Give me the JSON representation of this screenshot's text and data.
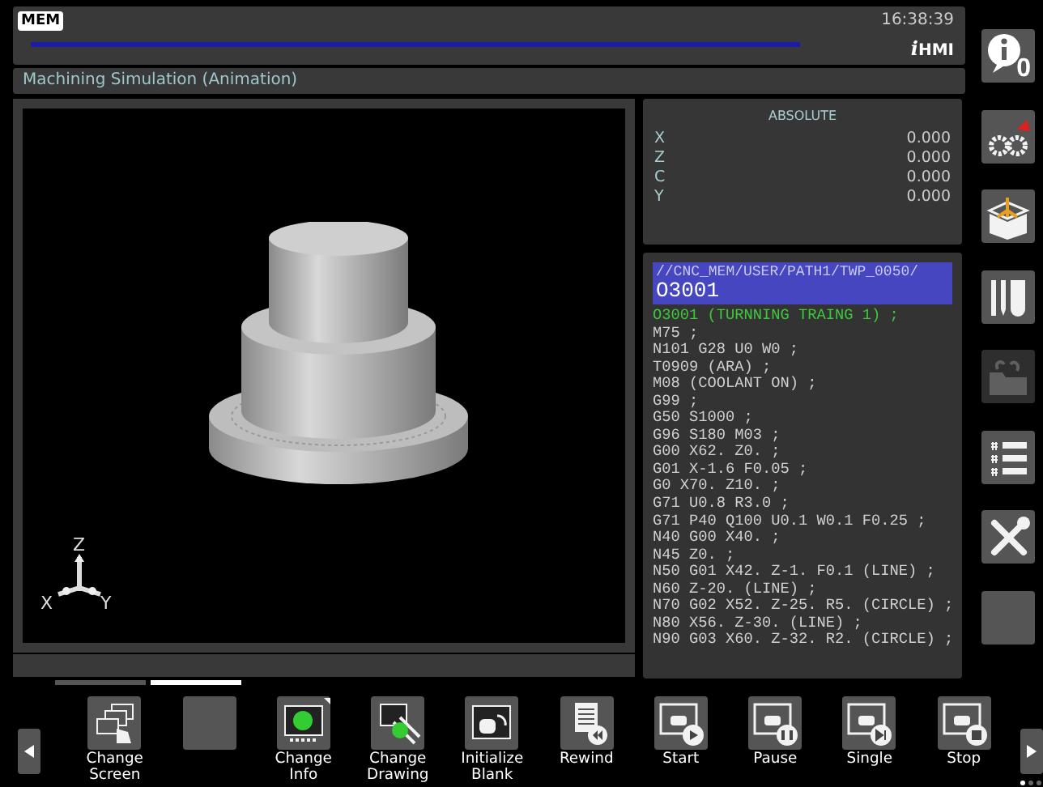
{
  "header": {
    "mode": "MEM",
    "time": "16:38:39",
    "logo": "iHMI"
  },
  "title": "Machining Simulation (Animation)",
  "simulation": {
    "axis_labels": [
      "Z",
      "X",
      "Y"
    ]
  },
  "position": {
    "title": "ABSOLUTE",
    "axes": [
      {
        "name": "X",
        "value": "0.000"
      },
      {
        "name": "Z",
        "value": "0.000"
      },
      {
        "name": "C",
        "value": "0.000"
      },
      {
        "name": "Y",
        "value": "0.000"
      }
    ]
  },
  "program": {
    "path": "//CNC_MEM/USER/PATH1/TWP_0050/",
    "name": "O3001",
    "lines": [
      {
        "text": "O3001 (TURNNING TRAING 1) ;",
        "current": true
      },
      {
        "text": "M75 ;",
        "current": false
      },
      {
        "text": "N101 G28 U0 W0 ;",
        "current": false
      },
      {
        "text": "T0909 (ARA) ;",
        "current": false
      },
      {
        "text": "M08 (COOLANT ON) ;",
        "current": false
      },
      {
        "text": "G99 ;",
        "current": false
      },
      {
        "text": "G50 S1000 ;",
        "current": false
      },
      {
        "text": "G96 S180 M03 ;",
        "current": false
      },
      {
        "text": "G00 X62. Z0. ;",
        "current": false
      },
      {
        "text": "G01 X-1.6 F0.05 ;",
        "current": false
      },
      {
        "text": "G0 X70. Z10. ;",
        "current": false
      },
      {
        "text": "G71 U0.8 R3.0 ;",
        "current": false
      },
      {
        "text": "G71 P40 Q100 U0.1 W0.1 F0.25 ;",
        "current": false
      },
      {
        "text": "N40 G00 X40. ;",
        "current": false
      },
      {
        "text": "N45 Z0. ;",
        "current": false
      },
      {
        "text": "N50 G01 X42. Z-1. F0.1 (LINE) ;",
        "current": false
      },
      {
        "text": "N60 Z-20. (LINE) ;",
        "current": false
      },
      {
        "text": "N70 G02 X52. Z-25. R5. (CIRCLE) ;",
        "current": false
      },
      {
        "text": "N80 X56. Z-30. (LINE) ;",
        "current": false
      },
      {
        "text": "N90 G03 X60. Z-32. R2. (CIRCLE) ;",
        "current": false
      }
    ]
  },
  "sidebar": {
    "alarm_count": "0",
    "items": [
      {
        "kind": "gears",
        "disabled": false
      },
      {
        "kind": "box",
        "disabled": false
      },
      {
        "kind": "tools",
        "disabled": false
      },
      {
        "kind": "folder",
        "disabled": true
      },
      {
        "kind": "list",
        "disabled": false
      },
      {
        "kind": "wrench",
        "disabled": false
      },
      {
        "kind": "blank",
        "disabled": false
      }
    ]
  },
  "softkey_pages": [
    {
      "selected": false
    },
    {
      "selected": true
    }
  ],
  "softkeys": [
    {
      "kind": "screens",
      "label": "Change\nScreen"
    },
    {
      "kind": "blank"
    },
    {
      "kind": "info",
      "label": "Change\nInfo"
    },
    {
      "kind": "drawing",
      "label": "Change\nDrawing"
    },
    {
      "kind": "blankreset",
      "label": "Initialize\nBlank"
    },
    {
      "kind": "rewind",
      "label": "Rewind"
    },
    {
      "kind": "start",
      "label": "Start"
    },
    {
      "kind": "pause",
      "label": "Pause"
    },
    {
      "kind": "single",
      "label": "Single"
    },
    {
      "kind": "stop",
      "label": "Stop"
    }
  ],
  "page_dots": [
    {
      "selected": true
    },
    {
      "selected": false
    },
    {
      "selected": false
    }
  ]
}
